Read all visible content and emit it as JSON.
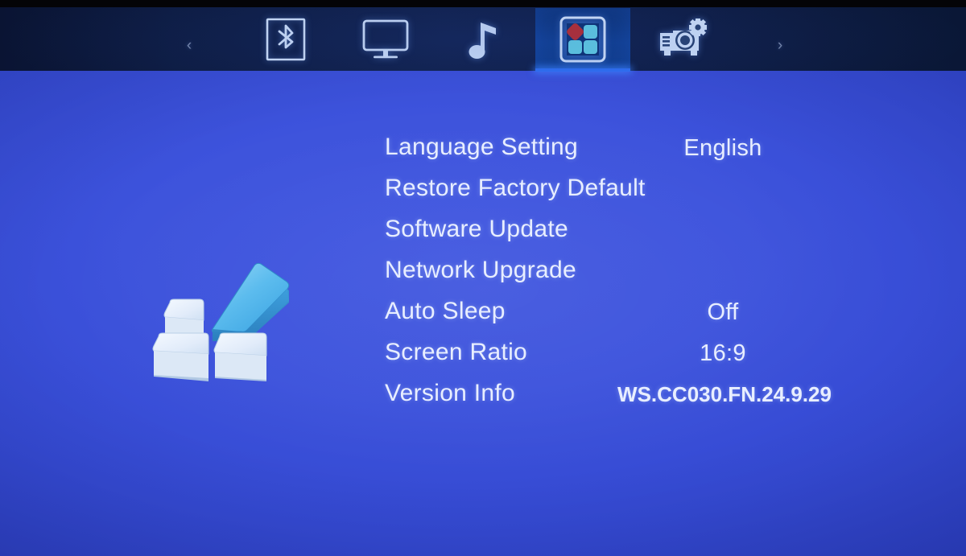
{
  "screen": {
    "background_color": "#3d53dc",
    "top_bar_color": "#0d1b40",
    "accent_color": "#2f6ef0"
  },
  "top_bar": {
    "prev_arrow": "‹",
    "next_arrow": "›",
    "tabs": [
      {
        "id": "bluetooth",
        "icon": "bluetooth-icon",
        "label": "Bluetooth",
        "selected": false
      },
      {
        "id": "display",
        "icon": "monitor-icon",
        "label": "Display",
        "selected": false
      },
      {
        "id": "music",
        "icon": "music-note-icon",
        "label": "Music",
        "selected": false
      },
      {
        "id": "apps",
        "icon": "apps-grid-icon",
        "label": "Settings",
        "selected": true
      },
      {
        "id": "projector",
        "icon": "projector-gear-icon",
        "label": "Projector",
        "selected": false
      }
    ],
    "selected_tab_id": "apps"
  },
  "logo": {
    "name": "windows-blocks-logo",
    "block_color": "#e4eefb",
    "accent_block_color": "#5cb8ee"
  },
  "settings": {
    "rows": [
      {
        "label": "Language Setting",
        "value": "English"
      },
      {
        "label": "Restore Factory Default",
        "value": ""
      },
      {
        "label": "Software Update",
        "value": ""
      },
      {
        "label": "Network Upgrade",
        "value": ""
      },
      {
        "label": "Auto Sleep",
        "value": "Off"
      },
      {
        "label": "Screen Ratio",
        "value": "16:9"
      },
      {
        "label": "Version Info",
        "value": "WS.CC030.FN.24.9.29"
      }
    ]
  }
}
